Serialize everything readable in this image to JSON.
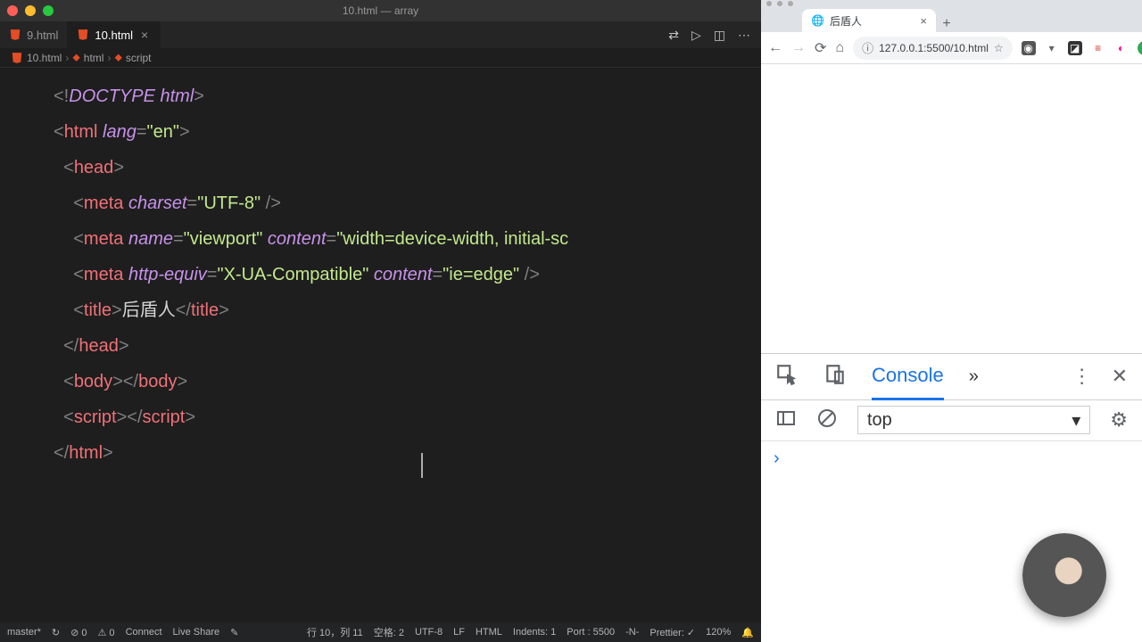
{
  "vscode": {
    "window_title": "10.html — array",
    "tabs": [
      {
        "label": "9.html",
        "active": false
      },
      {
        "label": "10.html",
        "active": true
      }
    ],
    "breadcrumb": [
      "10.html",
      "html",
      "script"
    ],
    "status": {
      "branch": "master*",
      "sync": "↻",
      "errors": "⊘ 0",
      "warnings": "⚠ 0",
      "connect": "Connect",
      "liveshare": "Live Share",
      "cursor": "行 10，列 11",
      "spaces": "空格: 2",
      "encoding": "UTF-8",
      "eol": "LF",
      "lang": "HTML",
      "indents": "Indents: 1",
      "port": "Port : 5500",
      "mode": "-N-",
      "prettier": "Prettier: ✓",
      "zoom": "120%",
      "bell": ""
    },
    "code": {
      "l1_doctype": "DOCTYPE",
      "l1_html_kw": "html",
      "l2_tag": "html",
      "l2_attr": "lang",
      "l2_val": "\"en\"",
      "l3_tag": "head",
      "l4_tag": "meta",
      "l4_attr": "charset",
      "l4_val": "\"UTF-8\"",
      "l5_tag": "meta",
      "l5_a1": "name",
      "l5_v1": "\"viewport\"",
      "l5_a2": "content",
      "l5_v2": "\"width=device-width, initial-sc",
      "l6_tag": "meta",
      "l6_a1": "http-equiv",
      "l6_v1": "\"X-UA-Compatible\"",
      "l6_a2": "content",
      "l6_v2": "\"ie=edge\"",
      "l7_tag": "title",
      "l7_text": "后盾人",
      "l8_tag": "head",
      "l9_tag": "body",
      "l10_tag": "script",
      "l11_tag": "html"
    }
  },
  "chrome": {
    "tab_title": "后盾人",
    "url": "127.0.0.1:5500/10.html",
    "devtools": {
      "tab_active": "Console",
      "context": "top",
      "prompt": "›"
    }
  }
}
